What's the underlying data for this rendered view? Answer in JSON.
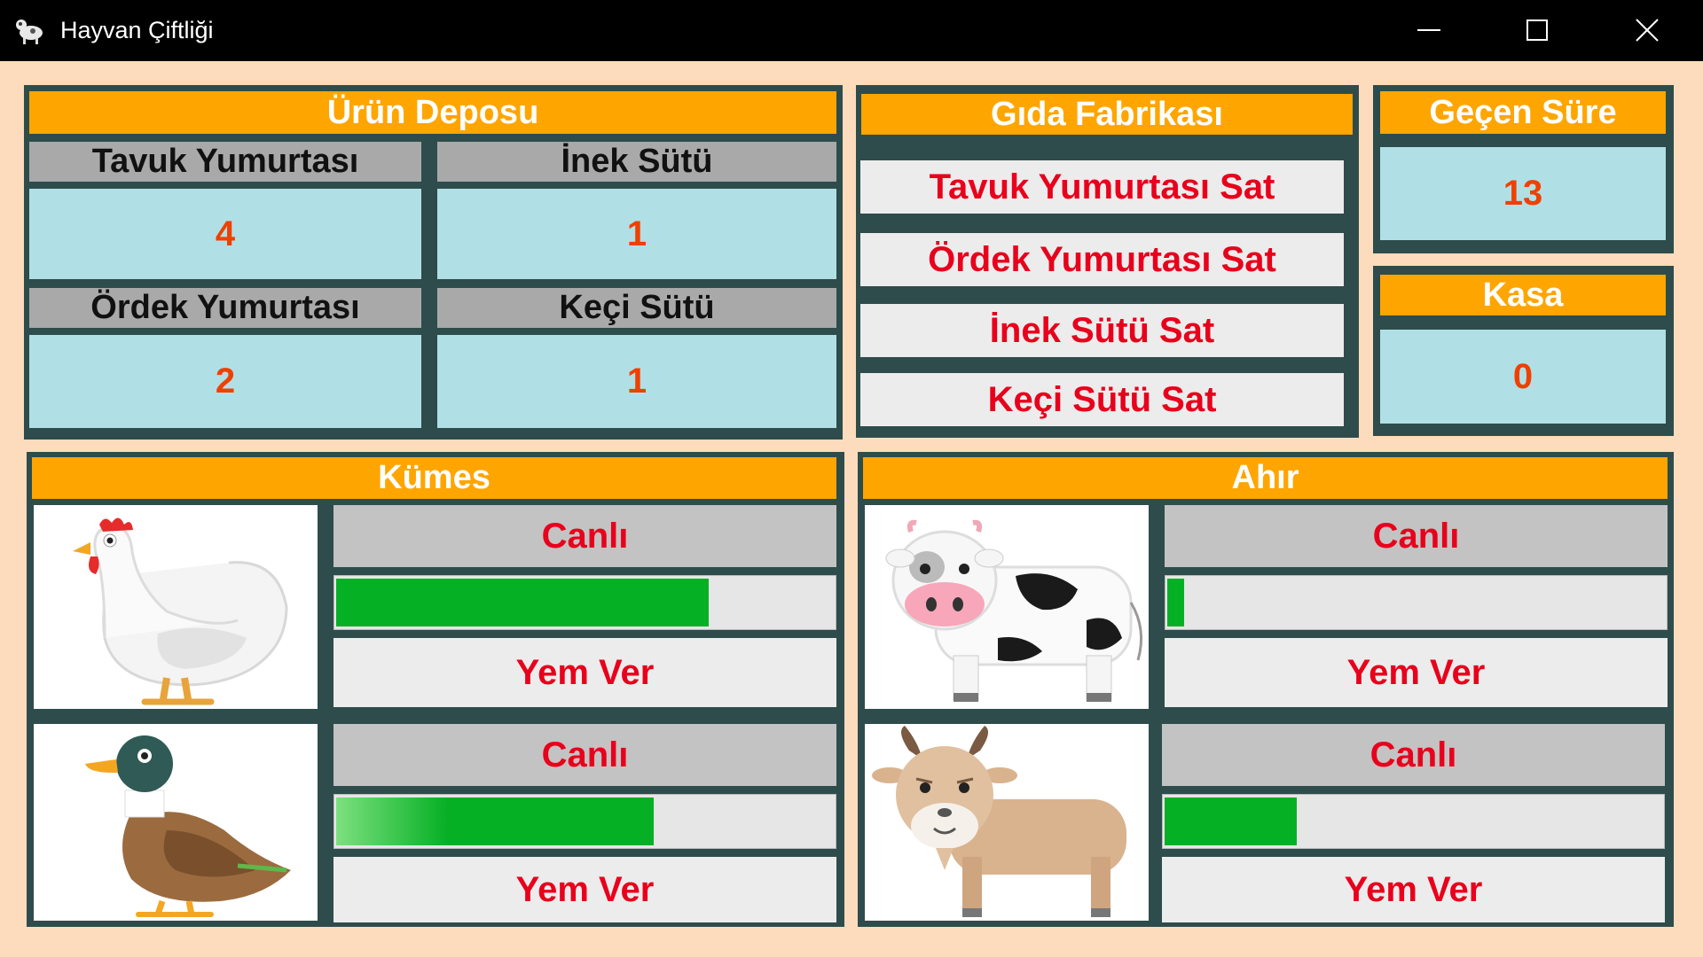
{
  "window": {
    "title": "Hayvan Çiftliği",
    "icon": "animal-farm-icon",
    "controls": [
      "minimize-icon",
      "maximize-icon",
      "close-icon"
    ]
  },
  "colors": {
    "header": "#ffa500",
    "panel": "#2e4c4c",
    "value_bg": "#b0e0e6",
    "value_text": "#f04000",
    "button_text": "#e8001c",
    "progress": "#06b025",
    "background": "#fcdcbc"
  },
  "depot": {
    "title": "Ürün Deposu",
    "items": [
      {
        "label": "Tavuk Yumurtası",
        "value": "4"
      },
      {
        "label": "İnek Sütü",
        "value": "1"
      },
      {
        "label": "Ördek Yumurtası",
        "value": "2"
      },
      {
        "label": "Keçi Sütü",
        "value": "1"
      }
    ]
  },
  "factory": {
    "title": "Gıda Fabrikası",
    "buttons": [
      "Tavuk Yumurtası Sat",
      "Ördek Yumurtası Sat",
      "İnek Sütü Sat",
      "Keçi Sütü Sat"
    ]
  },
  "timer": {
    "title": "Geçen Süre",
    "value": "13"
  },
  "cash": {
    "title": "Kasa",
    "value": "0"
  },
  "coop": {
    "title": "Kümes",
    "animals": [
      {
        "image": "chicken",
        "status": "Canlı",
        "health": 0.75,
        "feed_label": "Yem Ver"
      },
      {
        "image": "duck",
        "status": "Canlı",
        "health": 0.64,
        "feed_label": "Yem Ver"
      }
    ]
  },
  "barn": {
    "title": "Ahır",
    "animals": [
      {
        "image": "cow",
        "status": "Canlı",
        "health": 0.04,
        "feed_label": "Yem Ver"
      },
      {
        "image": "goat",
        "status": "Canlı",
        "health": 0.27,
        "feed_label": "Yem Ver"
      }
    ]
  }
}
